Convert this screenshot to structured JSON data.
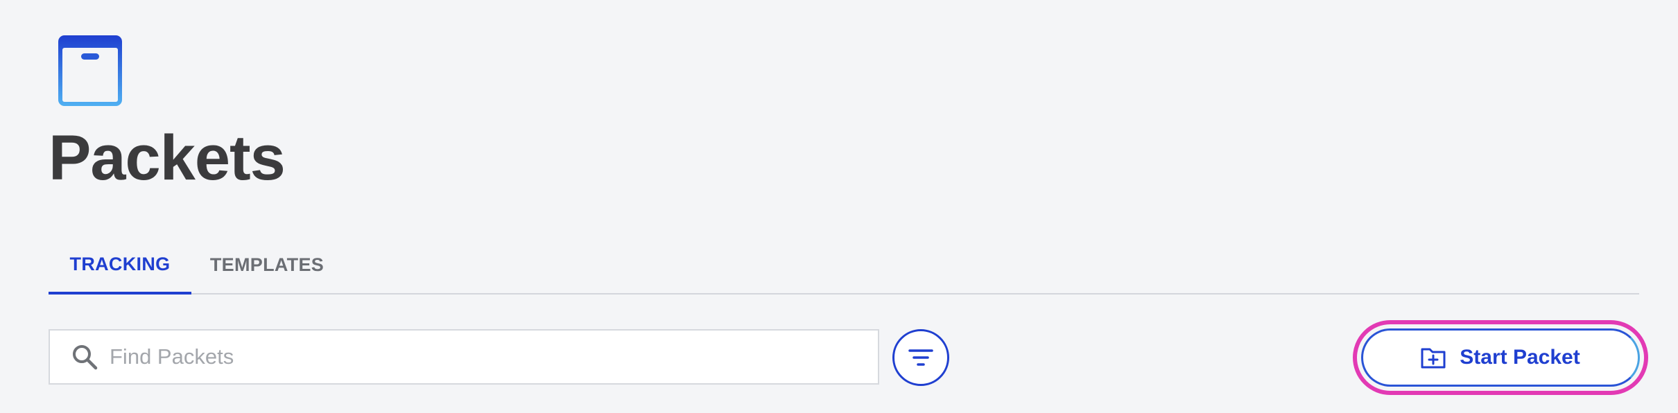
{
  "page": {
    "title": "Packets"
  },
  "tabs": [
    {
      "label": "TRACKING",
      "active": true
    },
    {
      "label": "TEMPLATES",
      "active": false
    }
  ],
  "search": {
    "placeholder": "Find Packets",
    "value": ""
  },
  "actions": {
    "start_packet_label": "Start Packet"
  },
  "icons": {
    "app": "packet-box-icon",
    "search": "search-icon",
    "filter": "filter-icon",
    "start": "folder-plus-icon"
  },
  "colors": {
    "accent": "#1f3fd0",
    "highlight": "#e23ab4",
    "title": "#3b3b3d",
    "background": "#f4f5f7"
  }
}
